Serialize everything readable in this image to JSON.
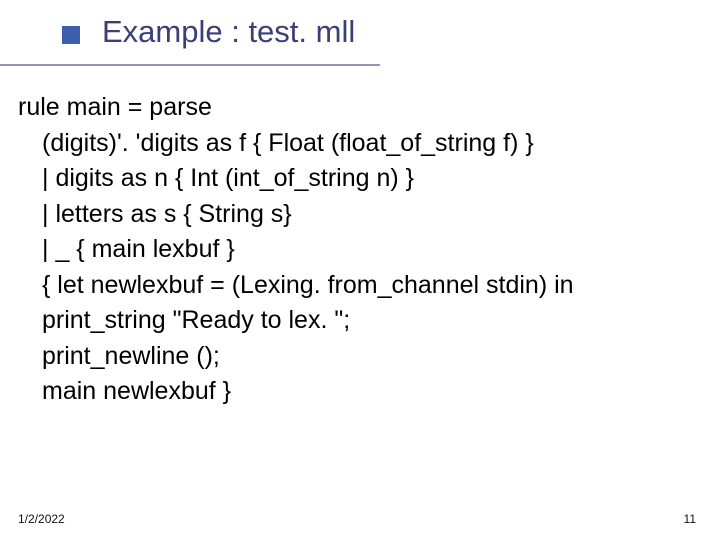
{
  "title": "Example : test. mll",
  "lines": {
    "l1": "rule main = parse",
    "l2": "(digits)'. 'digits as f  { Float (float_of_string f) }",
    "l3": "| digits as n               { Int (int_of_string n) }",
    "l4": "| letters as s               { String s}",
    "l5": "| _ { main lexbuf }",
    "l6": "{ let newlexbuf = (Lexing. from_channel stdin) in",
    "l7": "print_string \"Ready to lex. \";",
    "l8": "print_newline ();",
    "l9": "main newlexbuf  }"
  },
  "footer": {
    "date": "1/2/2022",
    "page": "11"
  }
}
